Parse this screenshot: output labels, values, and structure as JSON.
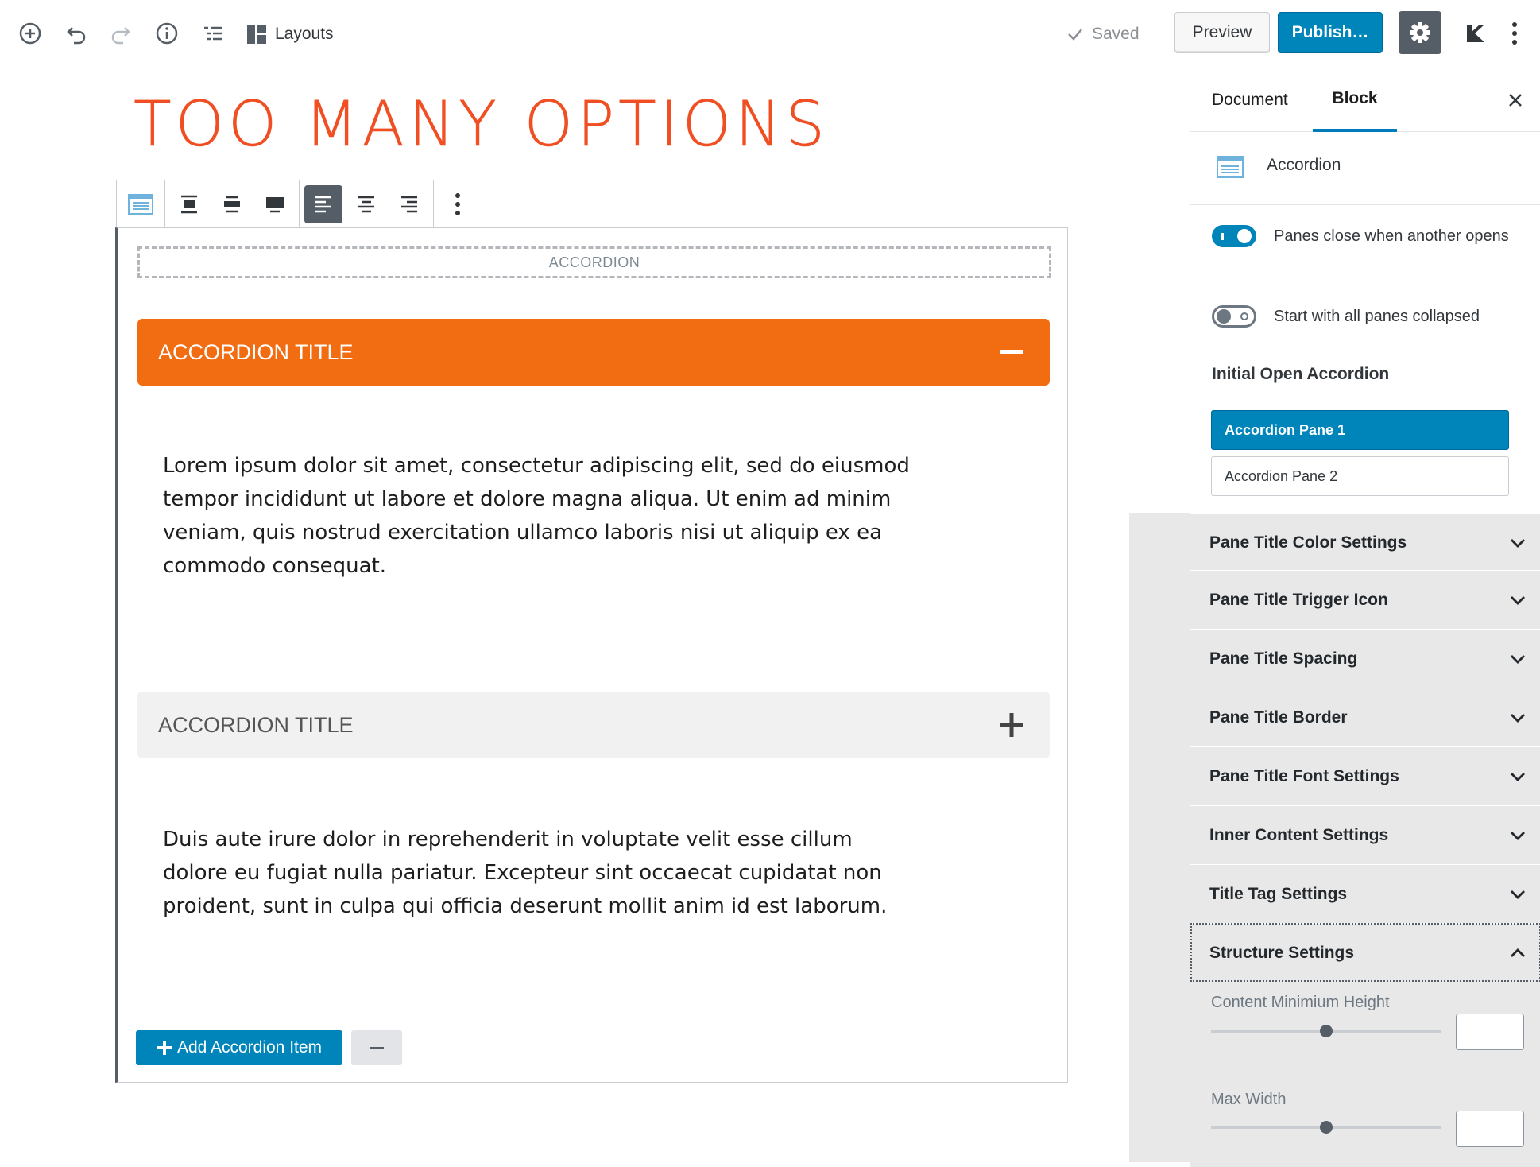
{
  "topbar": {
    "layouts_label": "Layouts",
    "saved_label": "Saved",
    "preview_label": "Preview",
    "publish_label": "Publish…"
  },
  "editor": {
    "page_title": "TOO MANY OPTIONS",
    "accordion_block_label": "ACCORDION",
    "panes": [
      {
        "title": "ACCORDION TITLE",
        "state": "open",
        "content": "Lorem ipsum dolor sit amet, consectetur adipiscing elit, sed do eiusmod tempor incididunt ut labore et dolore magna aliqua. Ut enim ad minim veniam, quis nostrud exercitation ullamco laboris nisi ut aliquip ex ea commodo consequat."
      },
      {
        "title": "ACCORDION TITLE",
        "state": "closed",
        "content": "Duis aute irure dolor in reprehenderit in voluptate velit esse cillum dolore eu fugiat nulla pariatur. Excepteur sint occaecat cupidatat non proident, sunt in culpa qui officia deserunt mollit anim id est laborum."
      }
    ],
    "add_item_label": "Add Accordion Item"
  },
  "sidebar": {
    "tabs": [
      "Document",
      "Block"
    ],
    "active_tab": "Block",
    "block_name": "Accordion",
    "toggles": [
      {
        "label": "Panes close when another opens",
        "on": true
      },
      {
        "label": "Start with all panes collapsed",
        "on": false
      }
    ],
    "initial_open_heading": "Initial Open Accordion",
    "pane_options": [
      "Accordion Pane 1",
      "Accordion Pane 2"
    ],
    "selected_pane": "Accordion Pane 1",
    "panels": [
      {
        "label": "Pane Title Color Settings",
        "expanded": false
      },
      {
        "label": "Pane Title Trigger Icon",
        "expanded": false
      },
      {
        "label": "Pane Title Spacing",
        "expanded": false
      },
      {
        "label": "Pane Title Border",
        "expanded": false
      },
      {
        "label": "Pane Title Font Settings",
        "expanded": false
      },
      {
        "label": "Inner Content Settings",
        "expanded": false
      },
      {
        "label": "Title Tag Settings",
        "expanded": false
      },
      {
        "label": "Structure Settings",
        "expanded": true
      }
    ],
    "structure_controls": [
      {
        "label": "Content Minimium Height",
        "value": 0.5,
        "input_value": ""
      },
      {
        "label": "Max Width",
        "value": 0.5,
        "input_value": ""
      }
    ]
  },
  "colors": {
    "accent_blue": "#0085ba",
    "title_red": "#f04e23",
    "pane_orange": "#f26c12",
    "pane_closed_gray": "#f1f1f1"
  }
}
